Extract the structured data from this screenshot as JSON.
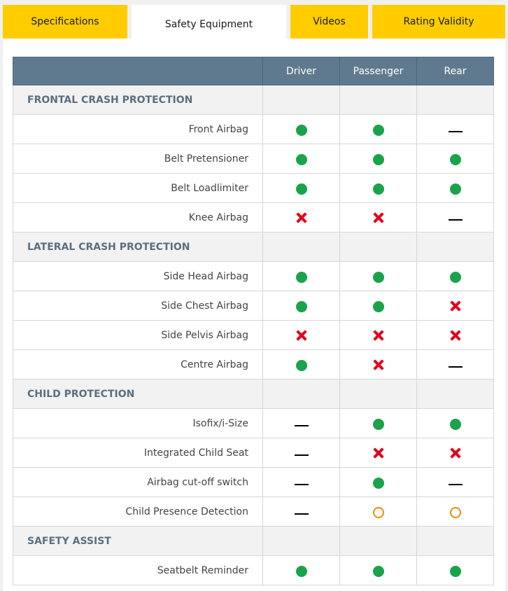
{
  "tabs": [
    {
      "label": "Specifications",
      "active": false
    },
    {
      "label": "Safety Equipment",
      "active": true
    },
    {
      "label": "Videos",
      "active": false
    },
    {
      "label": "Rating Validity",
      "active": false
    }
  ],
  "table": {
    "columns": [
      "Driver",
      "Passenger",
      "Rear"
    ],
    "status_icons": {
      "yes": "green-filled-circle",
      "no": "red-cross",
      "na": "black-dash",
      "option": "orange-hollow-circle"
    },
    "colors": {
      "header": "#5f7a8e",
      "tab": "#ffcc00",
      "yes": "#1aa34a",
      "no": "#e3001b",
      "option": "#f08c00",
      "section_text": "#5b6f80"
    },
    "sections": [
      {
        "title": "FRONTAL CRASH PROTECTION",
        "rows": [
          {
            "label": "Front Airbag",
            "values": [
              "yes",
              "yes",
              "na"
            ]
          },
          {
            "label": "Belt Pretensioner",
            "values": [
              "yes",
              "yes",
              "yes"
            ]
          },
          {
            "label": "Belt Loadlimiter",
            "values": [
              "yes",
              "yes",
              "yes"
            ]
          },
          {
            "label": "Knee Airbag",
            "values": [
              "no",
              "no",
              "na"
            ]
          }
        ]
      },
      {
        "title": "LATERAL CRASH PROTECTION",
        "rows": [
          {
            "label": "Side Head Airbag",
            "values": [
              "yes",
              "yes",
              "yes"
            ]
          },
          {
            "label": "Side Chest Airbag",
            "values": [
              "yes",
              "yes",
              "no"
            ]
          },
          {
            "label": "Side Pelvis Airbag",
            "values": [
              "no",
              "no",
              "no"
            ]
          },
          {
            "label": "Centre Airbag",
            "values": [
              "yes",
              "no",
              "na"
            ]
          }
        ]
      },
      {
        "title": "CHILD PROTECTION",
        "rows": [
          {
            "label": "Isofix/i-Size",
            "values": [
              "na",
              "yes",
              "yes"
            ]
          },
          {
            "label": "Integrated Child Seat",
            "values": [
              "na",
              "no",
              "no"
            ]
          },
          {
            "label": "Airbag cut-off switch",
            "values": [
              "na",
              "yes",
              "na"
            ]
          },
          {
            "label": "Child Presence Detection",
            "values": [
              "na",
              "option",
              "option"
            ]
          }
        ]
      },
      {
        "title": "SAFETY ASSIST",
        "rows": [
          {
            "label": "Seatbelt Reminder",
            "values": [
              "yes",
              "yes",
              "yes"
            ]
          }
        ]
      }
    ]
  }
}
